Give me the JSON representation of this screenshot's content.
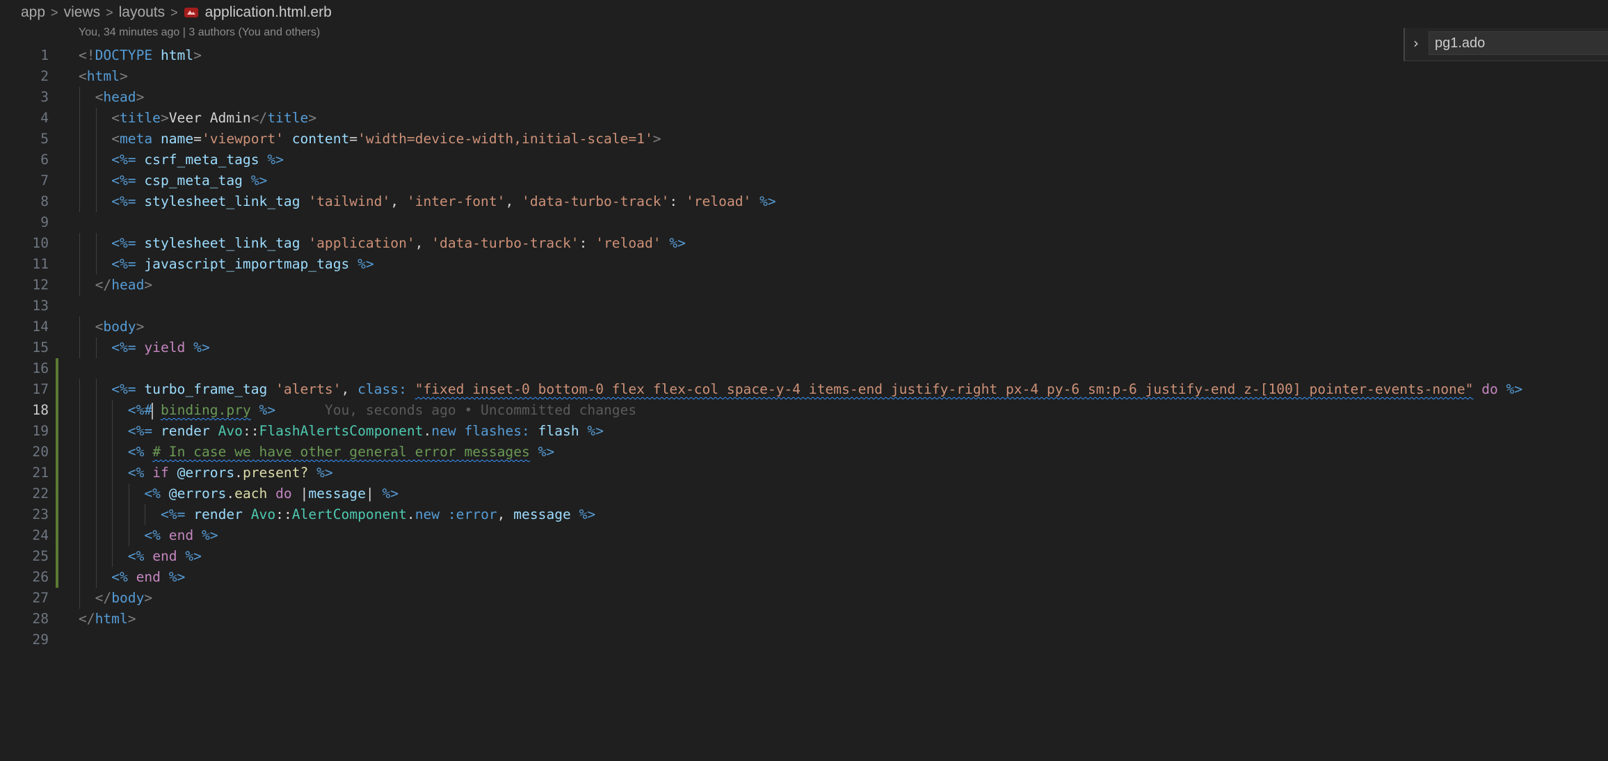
{
  "breadcrumb": {
    "items": [
      "app",
      "views",
      "layouts"
    ],
    "separator": ">",
    "file": "application.html.erb",
    "file_icon": "erb-file-icon"
  },
  "blame_header": "You, 34 minutes ago | 3 authors (You and others)",
  "find_widget": {
    "value": "pg1.ado",
    "chevron": "›"
  },
  "editor": {
    "active_line": 18,
    "modified_lines": [
      16,
      17,
      18,
      19,
      20,
      21,
      22,
      23,
      24,
      25,
      26
    ],
    "inline_blame": "You, seconds ago • Uncommitted changes",
    "lines": [
      {
        "n": "1",
        "indent": 0,
        "tokens": [
          [
            "t-punct",
            "<!"
          ],
          [
            "t-tag",
            "DOCTYPE"
          ],
          [
            "t-default",
            " "
          ],
          [
            "t-attr",
            "html"
          ],
          [
            "t-punct",
            ">"
          ]
        ]
      },
      {
        "n": "2",
        "indent": 0,
        "tokens": [
          [
            "t-punct",
            "<"
          ],
          [
            "t-tag",
            "html"
          ],
          [
            "t-punct",
            ">"
          ]
        ]
      },
      {
        "n": "3",
        "indent": 1,
        "tokens": [
          [
            "t-punct",
            "<"
          ],
          [
            "t-tag",
            "head"
          ],
          [
            "t-punct",
            ">"
          ]
        ]
      },
      {
        "n": "4",
        "indent": 2,
        "tokens": [
          [
            "t-punct",
            "<"
          ],
          [
            "t-tag",
            "title"
          ],
          [
            "t-punct",
            ">"
          ],
          [
            "t-text",
            "Veer Admin"
          ],
          [
            "t-punct",
            "</"
          ],
          [
            "t-tag",
            "title"
          ],
          [
            "t-punct",
            ">"
          ]
        ]
      },
      {
        "n": "5",
        "indent": 2,
        "tokens": [
          [
            "t-punct",
            "<"
          ],
          [
            "t-tag",
            "meta"
          ],
          [
            "t-default",
            " "
          ],
          [
            "t-attr",
            "name"
          ],
          [
            "t-default",
            "="
          ],
          [
            "t-str",
            "'viewport'"
          ],
          [
            "t-default",
            " "
          ],
          [
            "t-attr",
            "content"
          ],
          [
            "t-default",
            "="
          ],
          [
            "t-str",
            "'width=device-width,initial-scale=1'"
          ],
          [
            "t-punct",
            ">"
          ]
        ]
      },
      {
        "n": "6",
        "indent": 2,
        "tokens": [
          [
            "t-delim",
            "<%="
          ],
          [
            "t-default",
            " "
          ],
          [
            "t-id",
            "csrf_meta_tags"
          ],
          [
            "t-default",
            " "
          ],
          [
            "t-delim",
            "%>"
          ]
        ]
      },
      {
        "n": "7",
        "indent": 2,
        "tokens": [
          [
            "t-delim",
            "<%="
          ],
          [
            "t-default",
            " "
          ],
          [
            "t-id",
            "csp_meta_tag"
          ],
          [
            "t-default",
            " "
          ],
          [
            "t-delim",
            "%>"
          ]
        ]
      },
      {
        "n": "8",
        "indent": 2,
        "tokens": [
          [
            "t-delim",
            "<%="
          ],
          [
            "t-default",
            " "
          ],
          [
            "t-id",
            "stylesheet_link_tag"
          ],
          [
            "t-default",
            " "
          ],
          [
            "t-str",
            "'tailwind'"
          ],
          [
            "t-default",
            ", "
          ],
          [
            "t-str",
            "'inter-font'"
          ],
          [
            "t-default",
            ", "
          ],
          [
            "t-str",
            "'data-turbo-track'"
          ],
          [
            "t-default",
            ": "
          ],
          [
            "t-str",
            "'reload'"
          ],
          [
            "t-default",
            " "
          ],
          [
            "t-delim",
            "%>"
          ]
        ]
      },
      {
        "n": "9",
        "indent": 0,
        "tokens": []
      },
      {
        "n": "10",
        "indent": 2,
        "tokens": [
          [
            "t-delim",
            "<%="
          ],
          [
            "t-default",
            " "
          ],
          [
            "t-id",
            "stylesheet_link_tag"
          ],
          [
            "t-default",
            " "
          ],
          [
            "t-str",
            "'application'"
          ],
          [
            "t-default",
            ", "
          ],
          [
            "t-str",
            "'data-turbo-track'"
          ],
          [
            "t-default",
            ": "
          ],
          [
            "t-str",
            "'reload'"
          ],
          [
            "t-default",
            " "
          ],
          [
            "t-delim",
            "%>"
          ]
        ]
      },
      {
        "n": "11",
        "indent": 2,
        "tokens": [
          [
            "t-delim",
            "<%="
          ],
          [
            "t-default",
            " "
          ],
          [
            "t-id",
            "javascript_importmap_tags"
          ],
          [
            "t-default",
            " "
          ],
          [
            "t-delim",
            "%>"
          ]
        ]
      },
      {
        "n": "12",
        "indent": 1,
        "tokens": [
          [
            "t-punct",
            "</"
          ],
          [
            "t-tag",
            "head"
          ],
          [
            "t-punct",
            ">"
          ]
        ]
      },
      {
        "n": "13",
        "indent": 0,
        "tokens": []
      },
      {
        "n": "14",
        "indent": 1,
        "tokens": [
          [
            "t-punct",
            "<"
          ],
          [
            "t-tag",
            "body"
          ],
          [
            "t-punct",
            ">"
          ]
        ]
      },
      {
        "n": "15",
        "indent": 2,
        "tokens": [
          [
            "t-delim",
            "<%="
          ],
          [
            "t-default",
            " "
          ],
          [
            "t-kw",
            "yield"
          ],
          [
            "t-default",
            " "
          ],
          [
            "t-delim",
            "%>"
          ]
        ]
      },
      {
        "n": "16",
        "indent": 0,
        "tokens": []
      },
      {
        "n": "17",
        "indent": 2,
        "tokens": [
          [
            "t-delim",
            "<%="
          ],
          [
            "t-default",
            " "
          ],
          [
            "t-id",
            "turbo_frame_tag"
          ],
          [
            "t-default",
            " "
          ],
          [
            "t-str",
            "'alerts'"
          ],
          [
            "t-default",
            ", "
          ],
          [
            "t-sym",
            "class:"
          ],
          [
            "t-default",
            " "
          ],
          [
            "t-str squiggle",
            "\"fixed inset-0 bottom-0 flex flex-col space-y-4 items-end justify-right px-4 py-6 sm:p-6 justify-end z-[100] pointer-events-none\""
          ],
          [
            "t-default",
            " "
          ],
          [
            "t-kw",
            "do"
          ],
          [
            "t-default",
            " "
          ],
          [
            "t-delim",
            "%>"
          ]
        ]
      },
      {
        "n": "18",
        "indent": 3,
        "tokens": [
          [
            "t-delim",
            "<%#"
          ],
          [
            "cursor",
            ""
          ],
          [
            "t-default",
            " "
          ],
          [
            "t-comment squiggle",
            "binding.pry"
          ],
          [
            "t-default",
            " "
          ],
          [
            "t-delim",
            "%>"
          ]
        ],
        "blame": true
      },
      {
        "n": "19",
        "indent": 3,
        "tokens": [
          [
            "t-delim",
            "<%="
          ],
          [
            "t-default",
            " "
          ],
          [
            "t-id",
            "render"
          ],
          [
            "t-default",
            " "
          ],
          [
            "t-cls",
            "Avo"
          ],
          [
            "t-default",
            "::"
          ],
          [
            "t-cls",
            "FlashAlertsComponent"
          ],
          [
            "t-default",
            "."
          ],
          [
            "t-tag",
            "new"
          ],
          [
            "t-default",
            " "
          ],
          [
            "t-sym",
            "flashes:"
          ],
          [
            "t-default",
            " "
          ],
          [
            "t-id",
            "flash"
          ],
          [
            "t-default",
            " "
          ],
          [
            "t-delim",
            "%>"
          ]
        ]
      },
      {
        "n": "20",
        "indent": 3,
        "tokens": [
          [
            "t-delim",
            "<%"
          ],
          [
            "t-default",
            " "
          ],
          [
            "t-comment squiggle",
            "# In case we have other general error messages"
          ],
          [
            "t-default",
            " "
          ],
          [
            "t-delim",
            "%>"
          ]
        ]
      },
      {
        "n": "21",
        "indent": 3,
        "tokens": [
          [
            "t-delim",
            "<%"
          ],
          [
            "t-default",
            " "
          ],
          [
            "t-kw",
            "if"
          ],
          [
            "t-default",
            " "
          ],
          [
            "t-id",
            "@errors"
          ],
          [
            "t-default",
            "."
          ],
          [
            "t-fn",
            "present?"
          ],
          [
            "t-default",
            " "
          ],
          [
            "t-delim",
            "%>"
          ]
        ]
      },
      {
        "n": "22",
        "indent": 4,
        "tokens": [
          [
            "t-delim",
            "<%"
          ],
          [
            "t-default",
            " "
          ],
          [
            "t-id",
            "@errors"
          ],
          [
            "t-default",
            "."
          ],
          [
            "t-fn",
            "each"
          ],
          [
            "t-default",
            " "
          ],
          [
            "t-kw",
            "do"
          ],
          [
            "t-default",
            " |"
          ],
          [
            "t-id",
            "message"
          ],
          [
            "t-default",
            "| "
          ],
          [
            "t-delim",
            "%>"
          ]
        ]
      },
      {
        "n": "23",
        "indent": 5,
        "tokens": [
          [
            "t-delim",
            "<%="
          ],
          [
            "t-default",
            " "
          ],
          [
            "t-id",
            "render"
          ],
          [
            "t-default",
            " "
          ],
          [
            "t-cls",
            "Avo"
          ],
          [
            "t-default",
            "::"
          ],
          [
            "t-cls",
            "AlertComponent"
          ],
          [
            "t-default",
            "."
          ],
          [
            "t-tag",
            "new"
          ],
          [
            "t-default",
            " "
          ],
          [
            "t-sym",
            ":error"
          ],
          [
            "t-default",
            ", "
          ],
          [
            "t-id",
            "message"
          ],
          [
            "t-default",
            " "
          ],
          [
            "t-delim",
            "%>"
          ]
        ]
      },
      {
        "n": "24",
        "indent": 4,
        "tokens": [
          [
            "t-delim",
            "<%"
          ],
          [
            "t-default",
            " "
          ],
          [
            "t-kw",
            "end"
          ],
          [
            "t-default",
            " "
          ],
          [
            "t-delim",
            "%>"
          ]
        ]
      },
      {
        "n": "25",
        "indent": 3,
        "tokens": [
          [
            "t-delim",
            "<%"
          ],
          [
            "t-default",
            " "
          ],
          [
            "t-kw",
            "end"
          ],
          [
            "t-default",
            " "
          ],
          [
            "t-delim",
            "%>"
          ]
        ]
      },
      {
        "n": "26",
        "indent": 2,
        "tokens": [
          [
            "t-delim",
            "<%"
          ],
          [
            "t-default",
            " "
          ],
          [
            "t-kw",
            "end"
          ],
          [
            "t-default",
            " "
          ],
          [
            "t-delim",
            "%>"
          ]
        ]
      },
      {
        "n": "27",
        "indent": 1,
        "tokens": [
          [
            "t-punct",
            "</"
          ],
          [
            "t-tag",
            "body"
          ],
          [
            "t-punct",
            ">"
          ]
        ]
      },
      {
        "n": "28",
        "indent": 0,
        "tokens": [
          [
            "t-punct",
            "</"
          ],
          [
            "t-tag",
            "html"
          ],
          [
            "t-punct",
            ">"
          ]
        ]
      },
      {
        "n": "29",
        "indent": 0,
        "tokens": []
      }
    ]
  }
}
